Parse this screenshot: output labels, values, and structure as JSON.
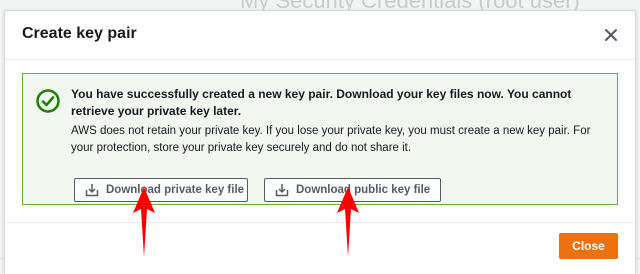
{
  "background": {
    "partial_heading": "My Security Credentials (root user)"
  },
  "dialog": {
    "title": "Create key pair",
    "close_icon": "close-icon"
  },
  "alert": {
    "type": "success",
    "icon": "check-circle-icon",
    "heading": "You have successfully created a new key pair. Download your key files now. You cannot retrieve your private key later.",
    "body": "AWS does not retain your private key. If you lose your private key, you must create a new key pair. For your protection, store your private key securely and do not share it."
  },
  "buttons": {
    "download_private": "Download private key file",
    "download_public": "Download public key file",
    "download_icon": "download-icon",
    "close": "Close"
  },
  "annotations": {
    "arrow_color": "#ff0000",
    "arrows": [
      "arrow-up",
      "arrow-up"
    ]
  },
  "colors": {
    "primary": "#ec7211",
    "success_border": "#6aaf35",
    "success_bg": "#f2f8f0",
    "success_icon": "#1d8102"
  }
}
